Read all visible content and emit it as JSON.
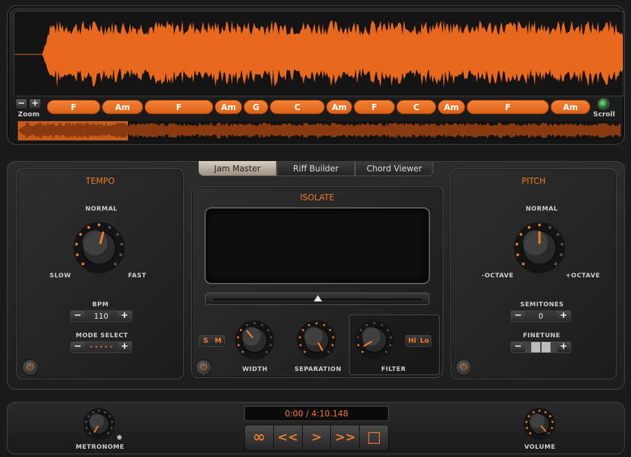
{
  "waveform": {
    "zoom_label": "Zoom",
    "zoom_out": "−",
    "zoom_in": "+",
    "scroll_label": "Scroll",
    "chords": [
      "F",
      "Am",
      "F",
      "Am",
      "G",
      "C",
      "Am",
      "F",
      "C",
      "Am",
      "F",
      "Am"
    ]
  },
  "tabs": [
    {
      "label": "Jam Master",
      "active": true
    },
    {
      "label": "Riff Builder",
      "active": false
    },
    {
      "label": "Chord Viewer",
      "active": false
    }
  ],
  "tempo": {
    "title": "TEMPO",
    "normal": "NORMAL",
    "slow": "SLOW",
    "fast": "FAST",
    "bpm_label": "BPM",
    "bpm_value": "110",
    "mode_label": "MODE SELECT",
    "mode_value": "• • • • •"
  },
  "isolate": {
    "title": "ISOLATE",
    "s_label": "S",
    "m_label": "M",
    "width_label": "WIDTH",
    "separation_label": "SEPARATION",
    "filter_label": "FILTER",
    "hi_label": "Hi",
    "lo_label": "Lo"
  },
  "pitch": {
    "title": "PITCH",
    "normal": "NORMAL",
    "minus_octave": "-OCTAVE",
    "plus_octave": "+OCTAVE",
    "semitones_label": "SEMITONES",
    "semitones_value": "0",
    "finetune_label": "FINETUNE"
  },
  "transport": {
    "time": "0:00 / 4:10.148",
    "loop": "∞",
    "rewind": "<<",
    "play": ">",
    "forward": ">>",
    "stop": "□",
    "metronome_label": "METRONOME",
    "volume_label": "VOLUME"
  },
  "stepper": {
    "minus": "−",
    "plus": "+"
  },
  "colors": {
    "accent": "#f27a2a",
    "waveform": "#e8691e"
  }
}
